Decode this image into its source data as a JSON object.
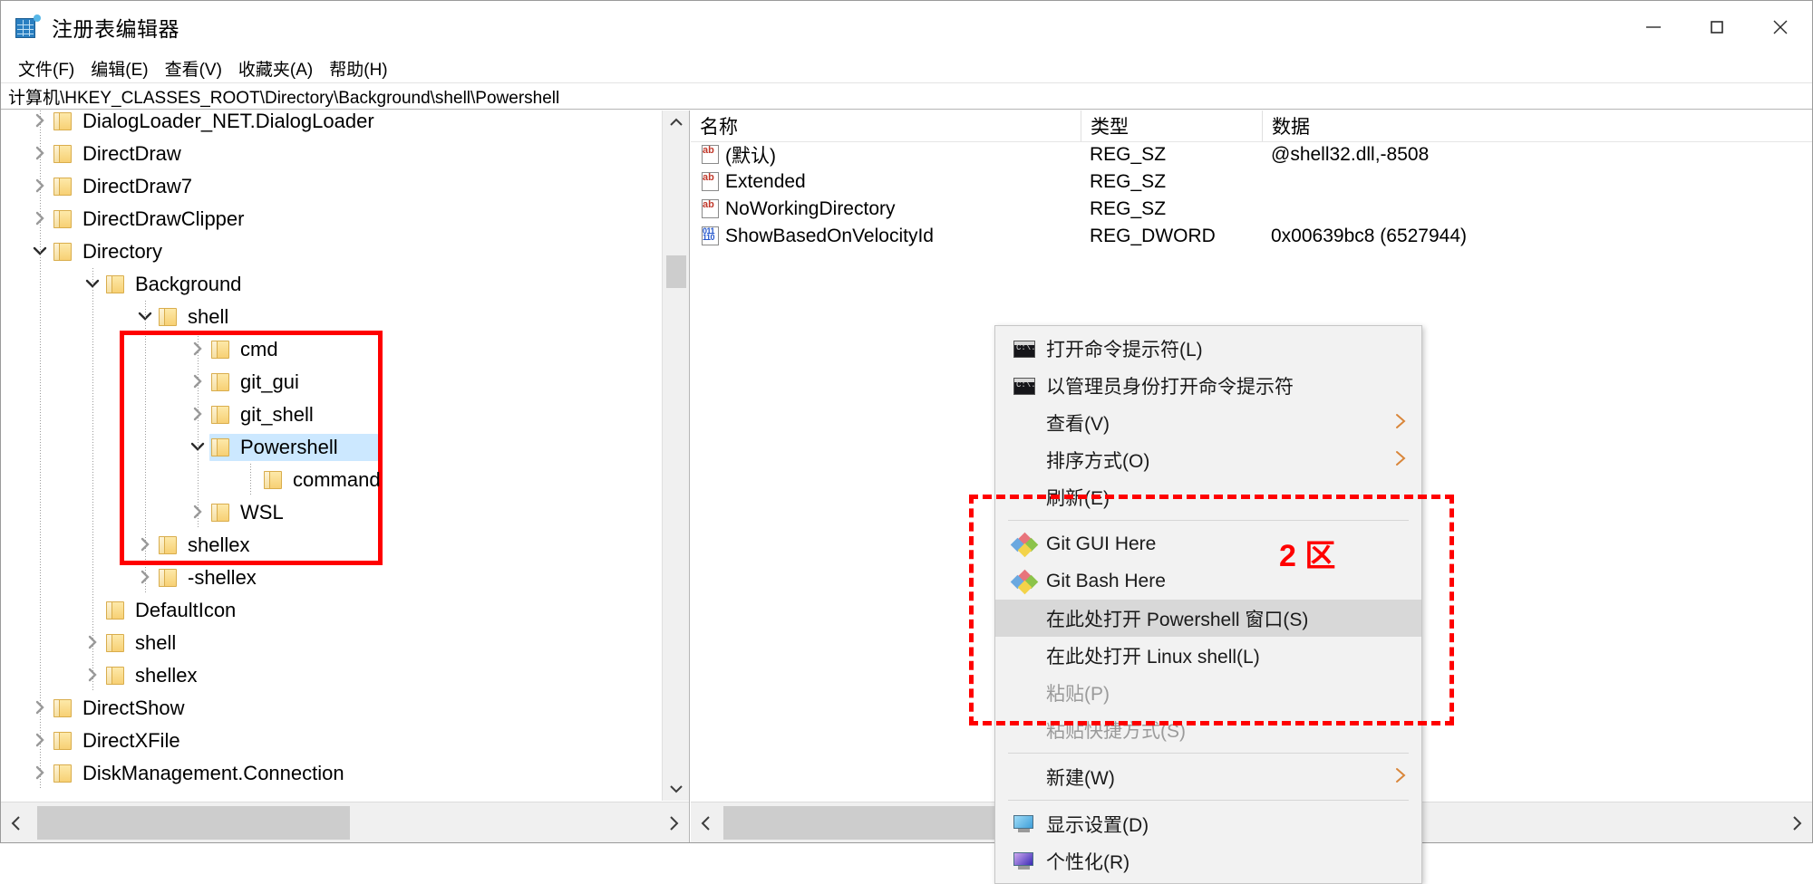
{
  "window": {
    "title": "注册表编辑器",
    "icon": "registry-editor-icon",
    "minimize": "—",
    "maximize": "□",
    "close": "✕"
  },
  "menubar": [
    {
      "label": "文件(F)",
      "name": "menu-file"
    },
    {
      "label": "编辑(E)",
      "name": "menu-edit"
    },
    {
      "label": "查看(V)",
      "name": "menu-view"
    },
    {
      "label": "收藏夹(A)",
      "name": "menu-favorites"
    },
    {
      "label": "帮助(H)",
      "name": "menu-help"
    }
  ],
  "address": {
    "value": "计算机\\HKEY_CLASSES_ROOT\\Directory\\Background\\shell\\Powershell"
  },
  "tree": {
    "nodes": [
      {
        "label": "DialogLoader_NET.DialogLoader",
        "depth": 1,
        "state": "collapsed"
      },
      {
        "label": "DirectDraw",
        "depth": 1,
        "state": "collapsed"
      },
      {
        "label": "DirectDraw7",
        "depth": 1,
        "state": "collapsed"
      },
      {
        "label": "DirectDrawClipper",
        "depth": 1,
        "state": "collapsed"
      },
      {
        "label": "Directory",
        "depth": 1,
        "state": "expanded"
      },
      {
        "label": "Background",
        "depth": 2,
        "state": "expanded"
      },
      {
        "label": "shell",
        "depth": 3,
        "state": "expanded"
      },
      {
        "label": "cmd",
        "depth": 4,
        "state": "collapsed"
      },
      {
        "label": "git_gui",
        "depth": 4,
        "state": "collapsed"
      },
      {
        "label": "git_shell",
        "depth": 4,
        "state": "collapsed"
      },
      {
        "label": "Powershell",
        "depth": 4,
        "state": "expanded",
        "selected": true
      },
      {
        "label": "command",
        "depth": 5,
        "state": "leaf"
      },
      {
        "label": "WSL",
        "depth": 4,
        "state": "collapsed"
      },
      {
        "label": "shellex",
        "depth": 3,
        "state": "collapsed"
      },
      {
        "label": "-shellex",
        "depth": 3,
        "state": "collapsed"
      },
      {
        "label": "DefaultIcon",
        "depth": 2,
        "state": "leaf"
      },
      {
        "label": "shell",
        "depth": 2,
        "state": "collapsed"
      },
      {
        "label": "shellex",
        "depth": 2,
        "state": "collapsed"
      },
      {
        "label": "DirectShow",
        "depth": 1,
        "state": "collapsed"
      },
      {
        "label": "DirectXFile",
        "depth": 1,
        "state": "collapsed"
      },
      {
        "label": "DiskManagement.Connection",
        "depth": 1,
        "state": "collapsed"
      }
    ]
  },
  "values": {
    "columns": [
      "名称",
      "类型",
      "数据"
    ],
    "rows": [
      {
        "name": "(默认)",
        "type": "REG_SZ",
        "data": "@shell32.dll,-8508",
        "icon": "string-value-icon"
      },
      {
        "name": "Extended",
        "type": "REG_SZ",
        "data": "",
        "icon": "string-value-icon"
      },
      {
        "name": "NoWorkingDirectory",
        "type": "REG_SZ",
        "data": "",
        "icon": "string-value-icon"
      },
      {
        "name": "ShowBasedOnVelocityId",
        "type": "REG_DWORD",
        "data": "0x00639bc8 (6527944)",
        "icon": "dword-value-icon"
      }
    ]
  },
  "context_menu": {
    "items": [
      {
        "label": "打开命令提示符(L)",
        "icon": "cmd-icon",
        "name": "ctx-open-cmd"
      },
      {
        "label": "以管理员身份打开命令提示符",
        "icon": "cmd-icon",
        "name": "ctx-open-cmd-admin"
      },
      {
        "label": "查看(V)",
        "icon": "",
        "submenu": true,
        "name": "ctx-view"
      },
      {
        "label": "排序方式(O)",
        "icon": "",
        "submenu": true,
        "name": "ctx-sort-by"
      },
      {
        "label": "刷新(E)",
        "icon": "",
        "name": "ctx-refresh"
      },
      {
        "separator": true
      },
      {
        "label": "Git GUI Here",
        "icon": "git-icon",
        "name": "ctx-git-gui-here"
      },
      {
        "label": "Git Bash Here",
        "icon": "git-icon",
        "name": "ctx-git-bash-here"
      },
      {
        "label": "在此处打开 Powershell 窗口(S)",
        "icon": "",
        "selected": true,
        "name": "ctx-open-powershell-here"
      },
      {
        "label": "在此处打开 Linux shell(L)",
        "icon": "",
        "name": "ctx-open-linux-shell-here"
      },
      {
        "label": "粘贴(P)",
        "icon": "",
        "disabled": true,
        "name": "ctx-paste"
      },
      {
        "label": "粘贴快捷方式(S)",
        "icon": "",
        "disabled": true,
        "name": "ctx-paste-shortcut"
      },
      {
        "separator": true
      },
      {
        "label": "新建(W)",
        "icon": "",
        "submenu": true,
        "name": "ctx-new"
      },
      {
        "separator": true
      },
      {
        "label": "显示设置(D)",
        "icon": "display-settings-icon",
        "name": "ctx-display-settings"
      },
      {
        "label": "个性化(R)",
        "icon": "personalize-icon",
        "name": "ctx-personalize"
      }
    ]
  },
  "annotations": {
    "region2_label": "2 区",
    "highlight_color": "#ff0000"
  },
  "scrollbars": {
    "left_up": "︿",
    "left_down": "﹀",
    "arrow_left": "❮",
    "arrow_right": "❯"
  }
}
